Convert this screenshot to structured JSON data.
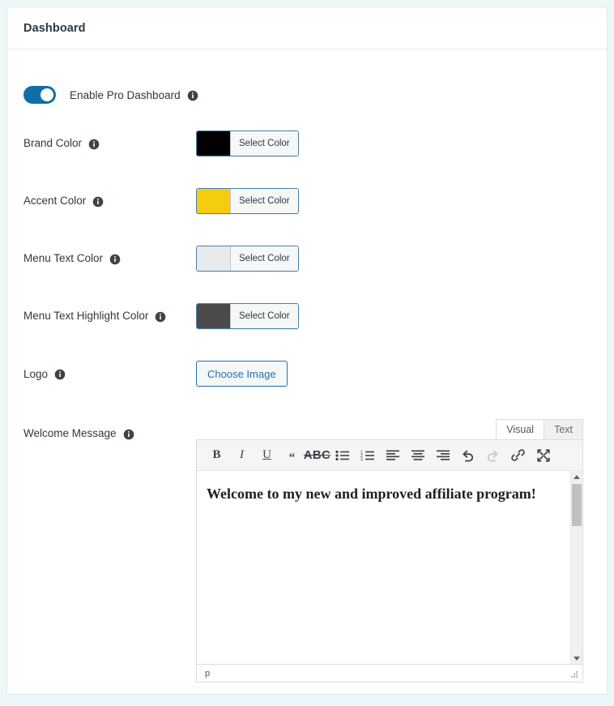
{
  "card": {
    "title": "Dashboard"
  },
  "toggle": {
    "label": "Enable Pro Dashboard",
    "state": "on",
    "color": "#0f6fa8",
    "info_icon": "info-icon"
  },
  "fields": [
    {
      "label": "Brand Color",
      "control": "color-picker",
      "button_label": "Select Color",
      "color": "#000000"
    },
    {
      "label": "Accent Color",
      "control": "color-picker",
      "button_label": "Select Color",
      "color": "#f5cd10"
    },
    {
      "label": "Menu Text Color",
      "control": "color-picker",
      "button_label": "Select Color",
      "color": "#e8eaec"
    },
    {
      "label": "Menu Text Highlight Color",
      "control": "color-picker",
      "button_label": "Select Color",
      "color": "#4a4a4a"
    },
    {
      "label": "Logo",
      "control": "media-button",
      "button_label": "Choose Image"
    }
  ],
  "welcome_message": {
    "label": "Welcome Message",
    "tabs": [
      {
        "label": "Visual",
        "active": true
      },
      {
        "label": "Text",
        "active": false
      }
    ],
    "toolbar": [
      {
        "name": "bold-icon",
        "glyph": "B",
        "enabled": true
      },
      {
        "name": "italic-icon",
        "glyph": "I",
        "enabled": true
      },
      {
        "name": "underline-icon",
        "glyph": "U",
        "enabled": true
      },
      {
        "name": "blockquote-icon",
        "glyph": "“",
        "enabled": true
      },
      {
        "name": "strikethrough-icon",
        "glyph": "ABC",
        "enabled": true
      },
      {
        "name": "bulleted-list-icon",
        "glyph": "",
        "enabled": true
      },
      {
        "name": "numbered-list-icon",
        "glyph": "",
        "enabled": true
      },
      {
        "name": "align-left-icon",
        "glyph": "",
        "enabled": true
      },
      {
        "name": "align-center-icon",
        "glyph": "",
        "enabled": true
      },
      {
        "name": "align-right-icon",
        "glyph": "",
        "enabled": true
      },
      {
        "name": "undo-icon",
        "glyph": "",
        "enabled": true
      },
      {
        "name": "redo-icon",
        "glyph": "",
        "enabled": false
      },
      {
        "name": "link-icon",
        "glyph": "",
        "enabled": true
      },
      {
        "name": "fullscreen-icon",
        "glyph": "",
        "enabled": true
      }
    ],
    "content": "Welcome to my new and improved affiliate program!",
    "status_path": "p"
  }
}
